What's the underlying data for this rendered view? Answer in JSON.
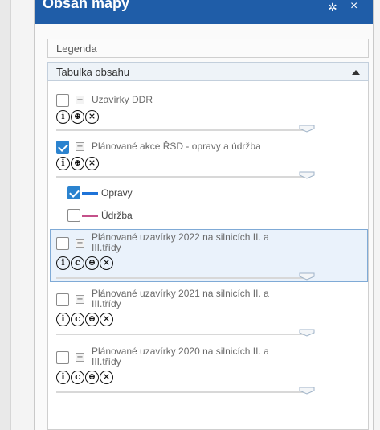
{
  "panel": {
    "title": "Obsah mapy"
  },
  "accordion": {
    "legend": "Legenda",
    "toc": "Tabulka obsahu"
  },
  "layers": [
    {
      "label": "Uzavírky DDR",
      "checked": false,
      "icons": [
        "i",
        "globe",
        "x"
      ]
    },
    {
      "label": "Plánované akce ŘSD - opravy a údržba",
      "checked": true,
      "icons": [
        "i",
        "globe",
        "x"
      ],
      "legend": [
        {
          "label": "Opravy",
          "checked": true,
          "color": "#1e73d8"
        },
        {
          "label": "Údržba",
          "checked": false,
          "color": "#c4508a"
        }
      ]
    },
    {
      "label_line1": "Plánované uzavírky 2022 na silnicích II. a",
      "label_line2": "III.třídy",
      "checked": false,
      "icons": [
        "i",
        "c",
        "globe",
        "x"
      ],
      "selected": true
    },
    {
      "label_line1": "Plánované uzavírky 2021 na silnicích II. a",
      "label_line2": "III.třídy",
      "checked": false,
      "icons": [
        "i",
        "c",
        "globe",
        "x"
      ]
    },
    {
      "label_line1": "Plánované uzavírky 2020 na silnicích II. a",
      "label_line2": "III.třídy",
      "checked": false,
      "icons": [
        "i",
        "c",
        "globe",
        "x"
      ]
    }
  ],
  "colors": {
    "header": "#1f5da8",
    "checkbox_checked": "#2b83cf",
    "selection": "#eaf2fb"
  }
}
